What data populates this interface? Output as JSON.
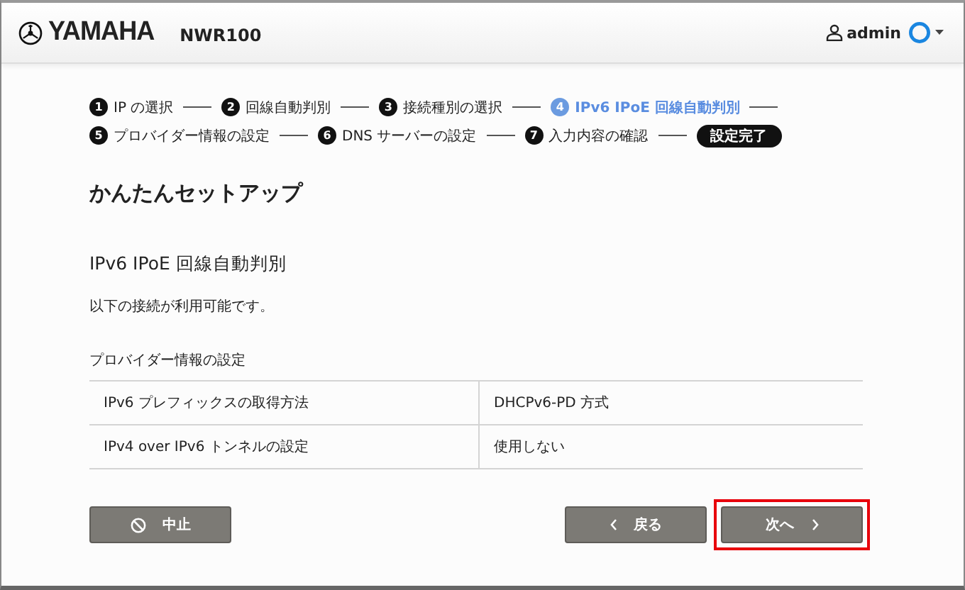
{
  "header": {
    "brand": "YAMAHA",
    "model": "NWR100",
    "user": "admin"
  },
  "step_rows": [
    {
      "steps": [
        {
          "number": "1",
          "label": "IP の選択",
          "current": false
        },
        {
          "number": "2",
          "label": "回線自動判別",
          "current": false
        },
        {
          "number": "3",
          "label": "接続種別の選択",
          "current": false
        },
        {
          "number": "4",
          "label": "IPv6 IPoE 回線自動判別",
          "current": true
        }
      ]
    },
    {
      "steps": [
        {
          "number": "5",
          "label": "プロバイダー情報の設定",
          "current": false
        },
        {
          "number": "6",
          "label": "DNS サーバーの設定",
          "current": false
        },
        {
          "number": "7",
          "label": "入力内容の確認",
          "current": false
        }
      ],
      "final": "設定完了"
    }
  ],
  "title": "かんたんセットアップ",
  "section": "IPv6 IPoE 回線自動判別",
  "description": "以下の接続が利用可能です。",
  "group_label": "プロバイダー情報の設定",
  "table": {
    "rows": [
      {
        "label": "IPv6 プレフィックスの取得方法",
        "value": "DHCPv6-PD 方式"
      },
      {
        "label": "IPv4 over IPv6 トンネルの設定",
        "value": "使用しない"
      }
    ]
  },
  "buttons": [
    {
      "kind": "cancel",
      "label": "中止",
      "highlighted": false
    },
    {
      "kind": "back",
      "label": "戻る",
      "highlighted": false
    },
    {
      "kind": "next",
      "label": "次へ",
      "highlighted": true
    }
  ]
}
